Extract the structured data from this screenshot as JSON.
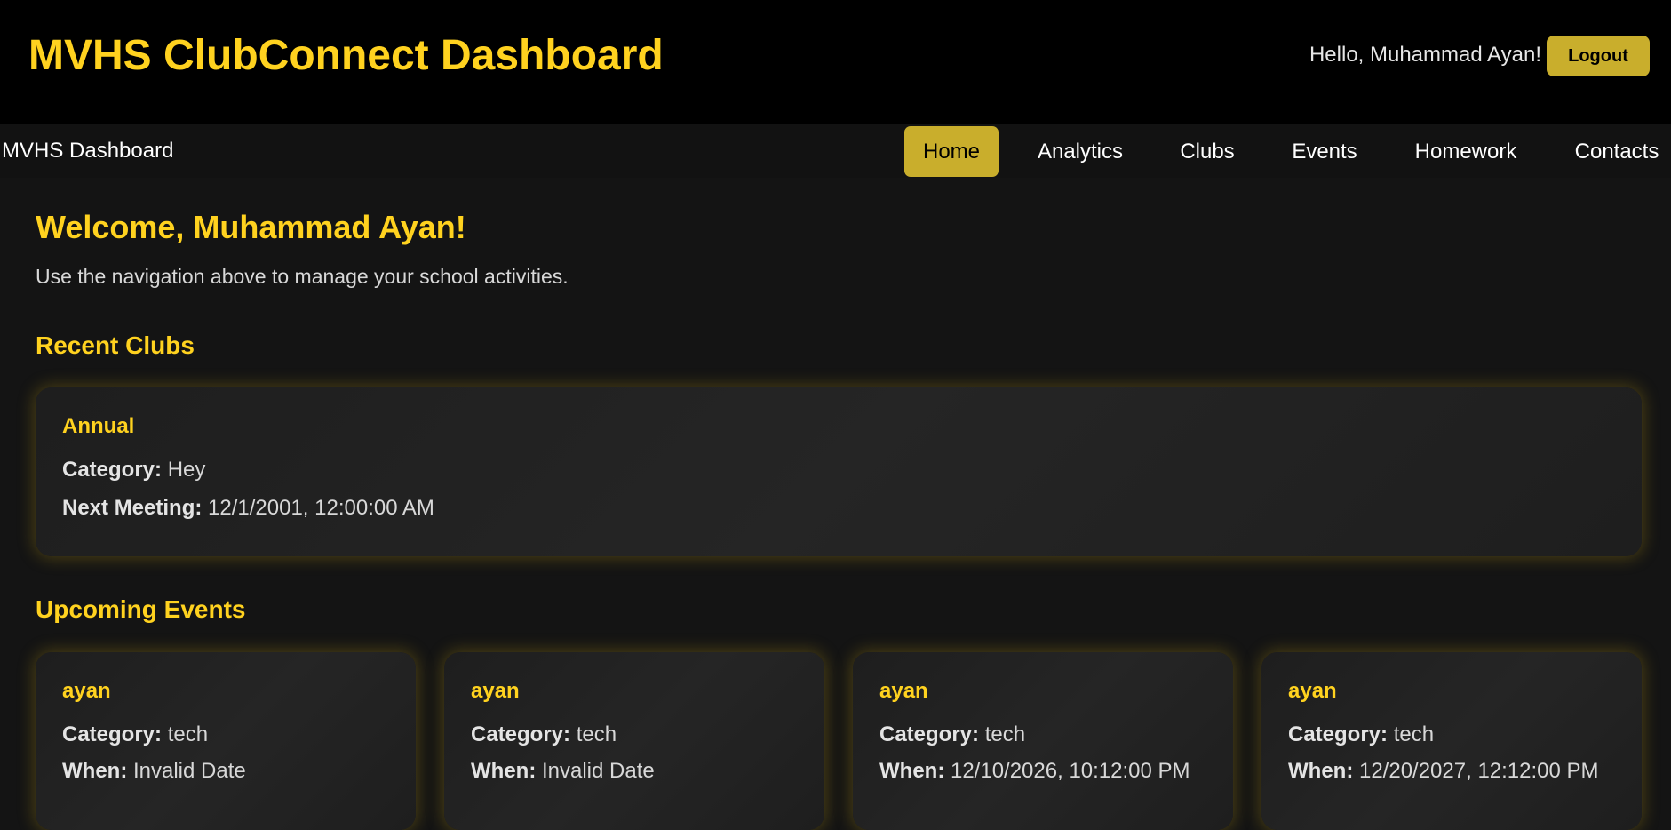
{
  "header": {
    "title": "MVHS ClubConnect Dashboard",
    "greeting": "Hello, Muhammad Ayan!",
    "logout_label": "Logout"
  },
  "nav": {
    "brand": "MVHS Dashboard",
    "items": [
      {
        "label": "Home"
      },
      {
        "label": "Analytics"
      },
      {
        "label": "Clubs"
      },
      {
        "label": "Events"
      },
      {
        "label": "Homework"
      },
      {
        "label": "Contacts"
      }
    ]
  },
  "main": {
    "welcome": "Welcome, Muhammad Ayan!",
    "intro": "Use the navigation above to manage your school activities.",
    "recent_clubs_heading": "Recent Clubs",
    "upcoming_events_heading": "Upcoming Events",
    "category_label": "Category:",
    "next_meeting_label": "Next Meeting:",
    "when_label": "When:",
    "clubs": [
      {
        "name": "Annual",
        "category": "Hey",
        "next_meeting": "12/1/2001, 12:00:00 AM"
      }
    ],
    "events": [
      {
        "name": "ayan",
        "category": "tech",
        "when": "Invalid Date"
      },
      {
        "name": "ayan",
        "category": "tech",
        "when": "Invalid Date"
      },
      {
        "name": "ayan",
        "category": "tech",
        "when": "12/10/2026, 10:12:00 PM"
      },
      {
        "name": "ayan",
        "category": "tech",
        "when": "12/20/2027, 12:12:00 PM"
      }
    ]
  },
  "colors": {
    "accent": "#FFD21F",
    "button": "#C9AE2C",
    "header_bg": "#000000",
    "page_bg": "#141414",
    "card_bg": "#222222"
  }
}
